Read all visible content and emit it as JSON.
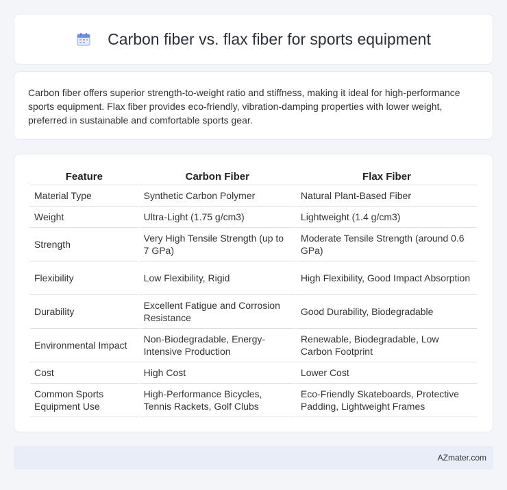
{
  "header": {
    "title": "Carbon fiber vs. flax fiber for sports equipment",
    "icon": "calendar-icon"
  },
  "summary": {
    "text": "Carbon fiber offers superior strength-to-weight ratio and stiffness, making it ideal for high-performance sports equipment. Flax fiber provides eco-friendly, vibration-damping properties with lower weight, preferred in sustainable and comfortable sports gear."
  },
  "table": {
    "headers": [
      "Feature",
      "Carbon Fiber",
      "Flax Fiber"
    ],
    "rows": [
      [
        "Material Type",
        "Synthetic Carbon Polymer",
        "Natural Plant-Based Fiber"
      ],
      [
        "Weight",
        "Ultra-Light (1.75 g/cm3)",
        "Lightweight (1.4 g/cm3)"
      ],
      [
        "Strength",
        "Very High Tensile Strength (up to 7 GPa)",
        "Moderate Tensile Strength (around 0.6 GPa)"
      ],
      [
        "Flexibility",
        "Low Flexibility, Rigid",
        "High Flexibility, Good Impact Absorption"
      ],
      [
        "Durability",
        "Excellent Fatigue and Corrosion Resistance",
        "Good Durability, Biodegradable"
      ],
      [
        "Environmental Impact",
        "Non-Biodegradable, Energy-Intensive Production",
        "Renewable, Biodegradable, Low Carbon Footprint"
      ],
      [
        "Cost",
        "High Cost",
        "Lower Cost"
      ],
      [
        "Common Sports Equipment Use",
        "High-Performance Bicycles, Tennis Rackets, Golf Clubs",
        "Eco-Friendly Skateboards, Protective Padding, Lightweight Frames"
      ]
    ]
  },
  "footer": {
    "text": "AZmater.com"
  },
  "colors": {
    "background": "#f3f5f9",
    "card": "#ffffff",
    "footer_bg": "#e8edf7"
  }
}
